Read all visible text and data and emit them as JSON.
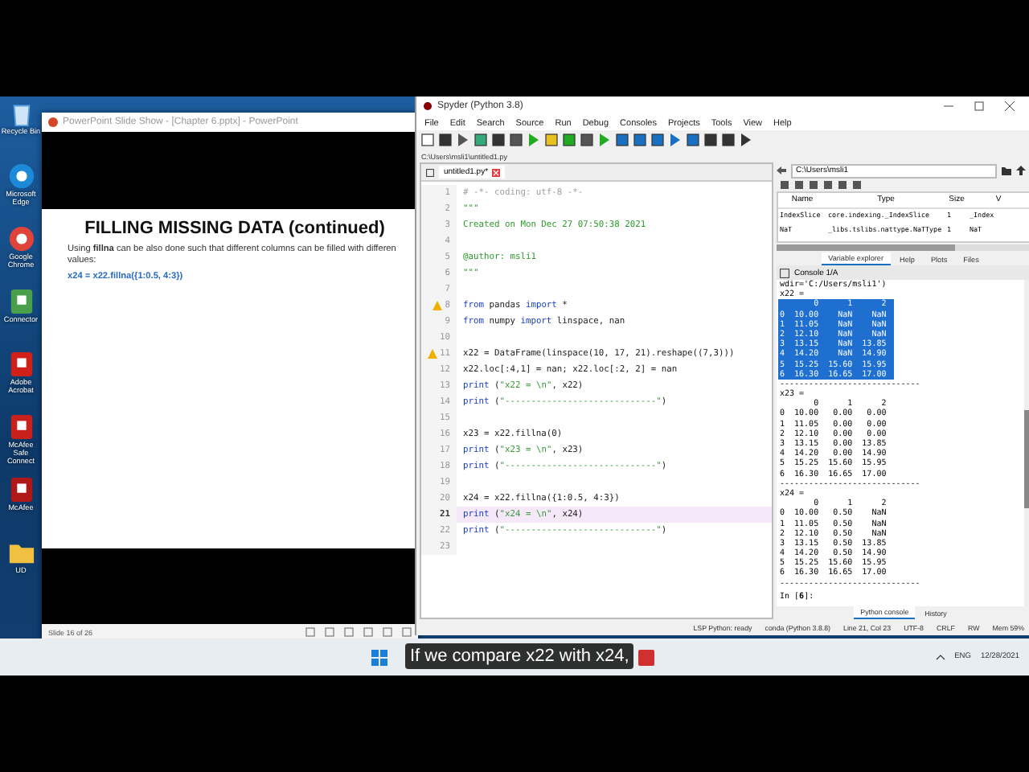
{
  "desktop_icons": [
    {
      "label": "Recycle Bin",
      "kind": "bin"
    },
    {
      "label": "Microsoft Edge",
      "kind": "edge"
    },
    {
      "label": "Google Chrome",
      "kind": "chrome"
    },
    {
      "label": "Connector",
      "kind": "doc"
    },
    {
      "label": "Adobe Acrobat",
      "kind": "pdf"
    },
    {
      "label": "McAfee Safe Connect",
      "kind": "lock"
    },
    {
      "label": "McAfee",
      "kind": "shield"
    },
    {
      "label": "UD",
      "kind": "folder"
    }
  ],
  "powerpoint": {
    "title": "PowerPoint Slide Show - [Chapter 6.pptx] - PowerPoint",
    "slide": {
      "title": "FILLING MISSING DATA (continued)",
      "body": [
        "Using **fillna** can be also done such that different columns can be filled with differen",
        "values:"
      ],
      "code": "x24 = x22.fillna({1:0.5, 4:3})"
    },
    "status": "Slide 16 of 26"
  },
  "spyder": {
    "title": "Spyder (Python 3.8)",
    "menu": [
      "File",
      "Edit",
      "Search",
      "Source",
      "Run",
      "Debug",
      "Consoles",
      "Projects",
      "Tools",
      "View",
      "Help"
    ],
    "file_path": "C:\\Users\\msli1\\untitled1.py",
    "editor_tab": "untitled1.py*",
    "editor_lines": [
      {
        "n": "1",
        "warning": false,
        "current": false,
        "parts": [
          {
            "kind": "comment",
            "t": "# -*- coding: utf-8 -*-"
          }
        ]
      },
      {
        "n": "2",
        "warning": false,
        "current": false,
        "parts": [
          {
            "kind": "docstring",
            "t": "\"\"\""
          }
        ]
      },
      {
        "n": "3",
        "warning": false,
        "current": false,
        "parts": [
          {
            "kind": "docstring",
            "t": "Created on Mon Dec 27 07:50:38 2021"
          }
        ]
      },
      {
        "n": "4",
        "warning": false,
        "current": false
      },
      {
        "n": "5",
        "warning": false,
        "current": false,
        "parts": [
          {
            "kind": "docstring",
            "t": "@author: msli1"
          }
        ]
      },
      {
        "n": "6",
        "warning": false,
        "current": false,
        "parts": [
          {
            "kind": "docstring",
            "t": "\"\"\""
          }
        ]
      },
      {
        "n": "7",
        "warning": false,
        "current": false
      },
      {
        "n": "8",
        "warning": true,
        "current": false,
        "parts": [
          {
            "kind": "keyword",
            "t": "from"
          },
          {
            "kind": "plain",
            "t": " pandas "
          },
          {
            "kind": "keyword",
            "t": "import"
          },
          {
            "kind": "plain",
            "t": " *"
          }
        ]
      },
      {
        "n": "9",
        "warning": false,
        "current": false,
        "parts": [
          {
            "kind": "keyword",
            "t": "from"
          },
          {
            "kind": "plain",
            "t": " numpy "
          },
          {
            "kind": "keyword",
            "t": "import"
          },
          {
            "kind": "plain",
            "t": " linspace, nan"
          }
        ]
      },
      {
        "n": "10",
        "warning": false,
        "current": false
      },
      {
        "n": "11",
        "warning": true,
        "current": false,
        "parts": [
          {
            "kind": "plain",
            "t": "x22 = DataFrame(linspace(10, 17, 21).reshape((7,3)))"
          }
        ]
      },
      {
        "n": "12",
        "warning": false,
        "current": false,
        "parts": [
          {
            "kind": "plain",
            "t": "x22.loc[:4,1] = nan; x22.loc[:2, 2] = nan"
          }
        ]
      },
      {
        "n": "13",
        "warning": false,
        "current": false,
        "parts": [
          {
            "kind": "keyword",
            "t": "print"
          },
          {
            "kind": "plain",
            "t": " ("
          },
          {
            "kind": "string",
            "t": "\"x22 = \\n\""
          },
          {
            "kind": "plain",
            "t": ", x22)"
          }
        ]
      },
      {
        "n": "14",
        "warning": false,
        "current": false,
        "parts": [
          {
            "kind": "keyword",
            "t": "print"
          },
          {
            "kind": "plain",
            "t": " ("
          },
          {
            "kind": "string",
            "t": "\"-----------------------------\""
          },
          {
            "kind": "plain",
            "t": ")"
          }
        ]
      },
      {
        "n": "15",
        "warning": false,
        "current": false
      },
      {
        "n": "16",
        "warning": false,
        "current": false,
        "parts": [
          {
            "kind": "plain",
            "t": "x23 = x22.fillna(0)"
          }
        ]
      },
      {
        "n": "17",
        "warning": false,
        "current": false,
        "parts": [
          {
            "kind": "keyword",
            "t": "print"
          },
          {
            "kind": "plain",
            "t": " ("
          },
          {
            "kind": "string",
            "t": "\"x23 = \\n\""
          },
          {
            "kind": "plain",
            "t": ", x23)"
          }
        ]
      },
      {
        "n": "18",
        "warning": false,
        "current": false,
        "parts": [
          {
            "kind": "keyword",
            "t": "print"
          },
          {
            "kind": "plain",
            "t": " ("
          },
          {
            "kind": "string",
            "t": "\"-----------------------------\""
          },
          {
            "kind": "plain",
            "t": ")"
          }
        ]
      },
      {
        "n": "19",
        "warning": false,
        "current": false
      },
      {
        "n": "20",
        "warning": false,
        "current": false,
        "parts": [
          {
            "kind": "plain",
            "t": "x24 = x22.fillna({1:0.5, 4:3})"
          }
        ]
      },
      {
        "n": "21",
        "warning": false,
        "current": true,
        "parts": [
          {
            "kind": "keyword",
            "t": "print"
          },
          {
            "kind": "plain",
            "t": " ("
          },
          {
            "kind": "string",
            "t": "\"x24 = \\n\""
          },
          {
            "kind": "plain",
            "t": ", x24)"
          }
        ]
      },
      {
        "n": "22",
        "warning": false,
        "current": false,
        "parts": [
          {
            "kind": "keyword",
            "t": "print"
          },
          {
            "kind": "plain",
            "t": " ("
          },
          {
            "kind": "string",
            "t": "\"-----------------------------\""
          },
          {
            "kind": "plain",
            "t": ")"
          }
        ]
      },
      {
        "n": "23",
        "warning": false,
        "current": false
      }
    ],
    "working_dir": "C:\\Users\\msli1",
    "variables": {
      "columns": [
        "Name",
        "Type",
        "Size",
        "V"
      ],
      "rows": [
        [
          "IndexSlice",
          "core.indexing._IndexSlice",
          "1",
          "_Index"
        ],
        [
          "NaT",
          "_libs.tslibs.nattype.NaTType",
          "1",
          "NaT"
        ]
      ]
    },
    "pane_tabs": [
      {
        "label": "Variable explorer",
        "selected": true
      },
      {
        "label": "Help",
        "selected": false
      },
      {
        "label": "Plots",
        "selected": false
      },
      {
        "label": "Files",
        "selected": false
      }
    ],
    "console_tab": "Console 1/A",
    "console_lines": [
      {
        "text": "wdir='C:/Users/msli1')",
        "selected": false
      },
      {
        "text": "x22 =",
        "selected": false
      },
      {
        "text": "       0      1      2",
        "selected": true
      },
      {
        "text": "0  10.00    NaN    NaN",
        "selected": true
      },
      {
        "text": "1  11.05    NaN    NaN",
        "selected": true
      },
      {
        "text": "2  12.10    NaN    NaN",
        "selected": true
      },
      {
        "text": "3  13.15    NaN  13.85",
        "selected": true
      },
      {
        "text": "4  14.20    NaN  14.90",
        "selected": true
      },
      {
        "text": "5  15.25  15.60  15.95",
        "selected": true
      },
      {
        "text": "6  16.30  16.65  17.00",
        "selected": true
      },
      {
        "text": "-----------------------------",
        "selected": false
      },
      {
        "text": "x23 =",
        "selected": false
      },
      {
        "text": "       0      1      2",
        "selected": false
      },
      {
        "text": "0  10.00   0.00   0.00",
        "selected": false
      },
      {
        "text": "1  11.05   0.00   0.00",
        "selected": false
      },
      {
        "text": "2  12.10   0.00   0.00",
        "selected": false
      },
      {
        "text": "3  13.15   0.00  13.85",
        "selected": false
      },
      {
        "text": "4  14.20   0.00  14.90",
        "selected": false
      },
      {
        "text": "5  15.25  15.60  15.95",
        "selected": false
      },
      {
        "text": "6  16.30  16.65  17.00",
        "selected": false
      },
      {
        "text": "-----------------------------",
        "selected": false
      },
      {
        "text": "x24 =",
        "selected": false
      },
      {
        "text": "       0      1      2",
        "selected": false
      },
      {
        "text": "0  10.00   0.50    NaN",
        "selected": false
      },
      {
        "text": "1  11.05   0.50    NaN",
        "selected": false
      },
      {
        "text": "2  12.10   0.50    NaN",
        "selected": false
      },
      {
        "text": "3  13.15   0.50  13.85",
        "selected": false
      },
      {
        "text": "4  14.20   0.50  14.90",
        "selected": false
      },
      {
        "text": "5  15.25  15.60  15.95",
        "selected": false
      },
      {
        "text": "6  16.30  16.65  17.00",
        "selected": false
      },
      {
        "text": "-----------------------------",
        "selected": false
      }
    ],
    "prompt": "In [**6**]:",
    "bottom_tabs": [
      {
        "label": "Python console",
        "selected": true
      },
      {
        "label": "History",
        "selected": false
      }
    ],
    "status": [
      "LSP Python: ready",
      "conda (Python 3.8.8)",
      "Line 21, Col 23",
      "UTF-8",
      "CRLF",
      "RW",
      "Mem 59%"
    ]
  },
  "taskbar": {
    "language": "ENG",
    "date": "12/28/2021"
  },
  "subtitle": "If we compare x22 with x24,"
}
